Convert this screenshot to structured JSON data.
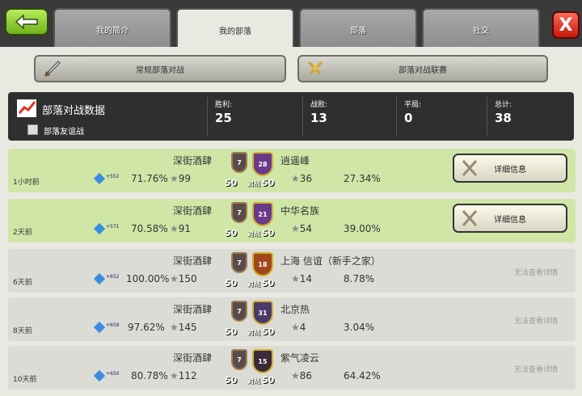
{
  "tabs": [
    {
      "label": "我的简介"
    },
    {
      "label": "我的部落"
    },
    {
      "label": "部落"
    },
    {
      "label": "社交"
    }
  ],
  "close_label": "X",
  "subtabs": {
    "regular": "常规部落对战",
    "league": "部落对战联赛"
  },
  "summary": {
    "title": "部落对战数据",
    "friendly_label": "部落友谊战",
    "wins_label": "胜利:",
    "wins": "25",
    "losses_label": "战败:",
    "losses": "13",
    "draws_label": "平局:",
    "draws": "0",
    "total_label": "总计:",
    "total": "38"
  },
  "detail_label": "详细信息",
  "no_view_label": "无法查看详情",
  "vs_label": "对战",
  "wars": [
    {
      "time": "1小时前",
      "xp": "+552",
      "pct1": "71.76%",
      "stars1": "99",
      "own_clan": "深街酒肆",
      "own_level": "7",
      "enemy_level": "28",
      "enemy_clan": "逍遥峰",
      "score1": "50",
      "score2": "50",
      "stars2": "36",
      "pct2": "27.34%"
    },
    {
      "time": "2天前",
      "xp": "+571",
      "pct1": "70.58%",
      "stars1": "91",
      "own_clan": "深街酒肆",
      "own_level": "7",
      "enemy_level": "21",
      "enemy_clan": "中华名族",
      "score1": "50",
      "score2": "50",
      "stars2": "54",
      "pct2": "39.00%"
    },
    {
      "time": "6天前",
      "xp": "+652",
      "pct1": "100.00%",
      "stars1": "150",
      "own_clan": "深街酒肆",
      "own_level": "7",
      "enemy_level": "18",
      "enemy_clan": "上海 信谊（新手之家）",
      "score1": "50",
      "score2": "50",
      "stars2": "14",
      "pct2": "8.78%"
    },
    {
      "time": "8天前",
      "xp": "+659",
      "pct1": "97.62%",
      "stars1": "145",
      "own_clan": "深街酒肆",
      "own_level": "7",
      "enemy_level": "31",
      "enemy_clan": "北京热",
      "score1": "50",
      "score2": "50",
      "stars2": "4",
      "pct2": "3.04%"
    },
    {
      "time": "10天前",
      "xp": "+650",
      "pct1": "80.78%",
      "stars1": "112",
      "own_clan": "深街酒肆",
      "own_level": "7",
      "enemy_level": "15",
      "enemy_clan": "紫气凌云",
      "score1": "50",
      "score2": "50",
      "stars2": "86",
      "pct2": "64.42%"
    }
  ],
  "colors": {
    "won_row": "#cfe6a7",
    "lost_row": "#dcdcd6",
    "accent": "#6fb21c"
  }
}
